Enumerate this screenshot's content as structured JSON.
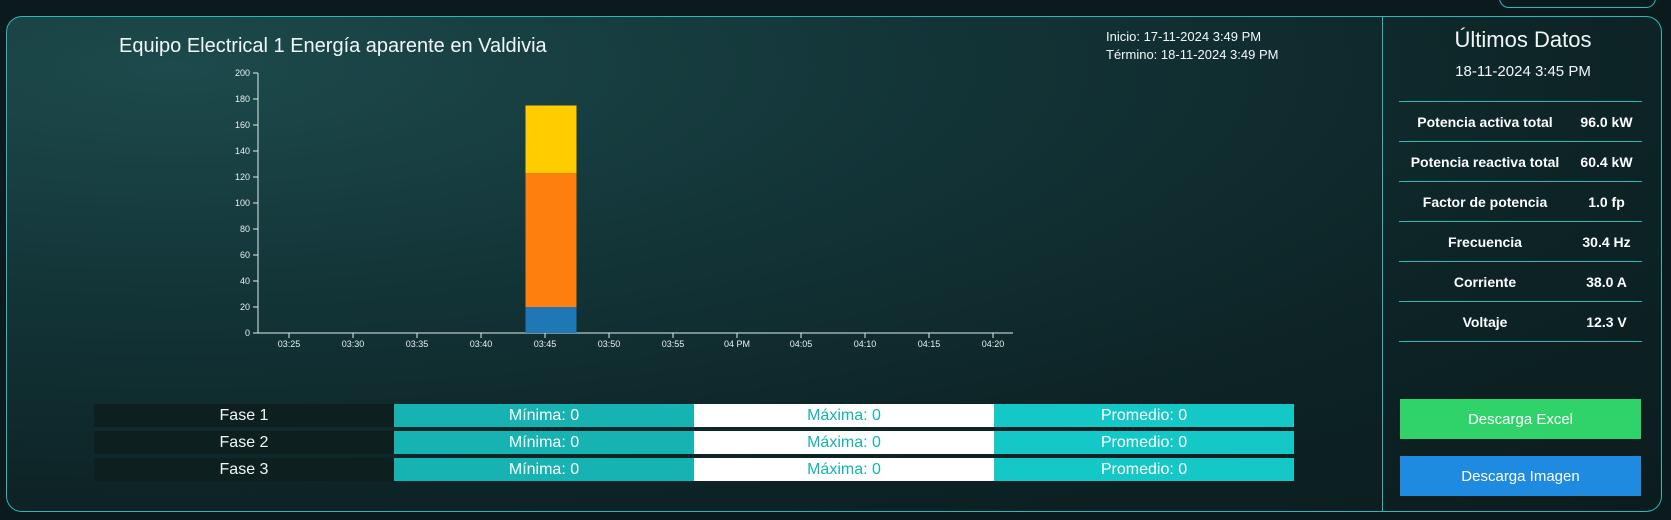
{
  "chart_panel": {
    "title": "Equipo Electrical 1 Energía aparente en Valdivia",
    "start": "Inicio: 17-11-2024 3:49 PM",
    "end": "Término: 18-11-2024 3:49 PM"
  },
  "chart_data": {
    "type": "bar",
    "stacked": true,
    "y_ticks": [
      0,
      20,
      40,
      60,
      80,
      100,
      120,
      140,
      160,
      180,
      200
    ],
    "ylim": [
      0,
      200
    ],
    "x_ticks": [
      "03:25",
      "03:30",
      "03:35",
      "03:40",
      "03:45",
      "03:50",
      "03:55",
      "04 PM",
      "04:05",
      "04:10",
      "04:15",
      "04:20"
    ],
    "categories": [
      "03:45"
    ],
    "series": [
      {
        "values": [
          20
        ],
        "color": "#1f77b4"
      },
      {
        "values": [
          103
        ],
        "color": "#ff7f0e"
      },
      {
        "values": [
          52
        ],
        "color": "#ffcc00"
      }
    ],
    "grid": false
  },
  "stats": [
    {
      "label": "Fase 1",
      "min": "Mínima: 0",
      "max": "Máxima: 0",
      "avg": "Promedio: 0"
    },
    {
      "label": "Fase 2",
      "min": "Mínima: 0",
      "max": "Máxima: 0",
      "avg": "Promedio: 0"
    },
    {
      "label": "Fase 3",
      "min": "Mínima: 0",
      "max": "Máxima: 0",
      "avg": "Promedio: 0"
    }
  ],
  "latest": {
    "title": "Últimos Datos",
    "date": "18-11-2024 3:45 PM",
    "rows": [
      {
        "label": "Potencia activa total",
        "value": "96.0 kW"
      },
      {
        "label": "Potencia reactiva total",
        "value": "60.4 kW"
      },
      {
        "label": "Factor de potencia",
        "value": "1.0 fp"
      },
      {
        "label": "Frecuencia",
        "value": "30.4 Hz"
      },
      {
        "label": "Corriente",
        "value": "38.0 A"
      },
      {
        "label": "Voltaje",
        "value": "12.3 V"
      }
    ],
    "excel_button": "Descarga Excel",
    "image_button": "Descarga Imagen"
  }
}
